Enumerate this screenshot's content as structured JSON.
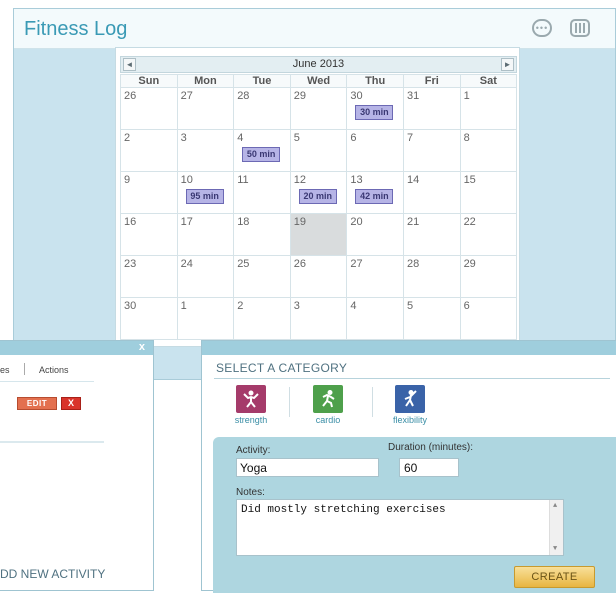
{
  "app": {
    "title": "Fitness Log"
  },
  "header_icons": [
    "chat-icon",
    "settings-sliders-icon"
  ],
  "calendar": {
    "month_label": "June 2013",
    "prev_icon": "◄",
    "next_icon": "►",
    "weekdays": [
      "Sun",
      "Mon",
      "Tue",
      "Wed",
      "Thu",
      "Fri",
      "Sat"
    ],
    "weeks": [
      [
        {
          "d": "26"
        },
        {
          "d": "27"
        },
        {
          "d": "28"
        },
        {
          "d": "29"
        },
        {
          "d": "30",
          "event": "30 min"
        },
        {
          "d": "31"
        },
        {
          "d": "1"
        }
      ],
      [
        {
          "d": "2"
        },
        {
          "d": "3"
        },
        {
          "d": "4",
          "event": "50 min"
        },
        {
          "d": "5"
        },
        {
          "d": "6"
        },
        {
          "d": "7"
        },
        {
          "d": "8"
        }
      ],
      [
        {
          "d": "9"
        },
        {
          "d": "10",
          "event": "95 min"
        },
        {
          "d": "11"
        },
        {
          "d": "12",
          "event": "20 min"
        },
        {
          "d": "13",
          "event": "42 min"
        },
        {
          "d": "14"
        },
        {
          "d": "15"
        }
      ],
      [
        {
          "d": "16"
        },
        {
          "d": "17"
        },
        {
          "d": "18"
        },
        {
          "d": "19",
          "today": true
        },
        {
          "d": "20"
        },
        {
          "d": "21"
        },
        {
          "d": "22"
        }
      ],
      [
        {
          "d": "23"
        },
        {
          "d": "24"
        },
        {
          "d": "25"
        },
        {
          "d": "26"
        },
        {
          "d": "27"
        },
        {
          "d": "28"
        },
        {
          "d": "29"
        }
      ],
      [
        {
          "d": "30"
        },
        {
          "d": "1"
        },
        {
          "d": "2"
        },
        {
          "d": "3"
        },
        {
          "d": "4"
        },
        {
          "d": "5"
        },
        {
          "d": "6"
        }
      ]
    ]
  },
  "left_panel": {
    "close_label": "x",
    "col_partial": "es",
    "col_actions": "Actions",
    "edit_label": "EDIT",
    "delete_label": "X",
    "add_activity": "DD NEW ACTIVITY"
  },
  "right_panel": {
    "heading": "SELECT A CATEGORY",
    "categories": [
      {
        "label": "strength",
        "icon": "strength-figure-icon",
        "color": "#a53b6a"
      },
      {
        "label": "cardio",
        "icon": "running-figure-icon",
        "color": "#4ea04b"
      },
      {
        "label": "flexibility",
        "icon": "stretching-figure-icon",
        "color": "#3a63a8"
      }
    ],
    "form": {
      "activity_label": "Activity:",
      "activity_value": "Yoga",
      "duration_label": "Duration (minutes):",
      "duration_value": "60",
      "notes_label": "Notes:",
      "notes_value": "Did mostly stretching exercises",
      "create_label": "CREATE"
    }
  },
  "colors": {
    "title": "#3a9ab5",
    "event_fill": "#b6b4e6",
    "form_bg": "#aed6e0",
    "create_button": "#e8b541"
  }
}
